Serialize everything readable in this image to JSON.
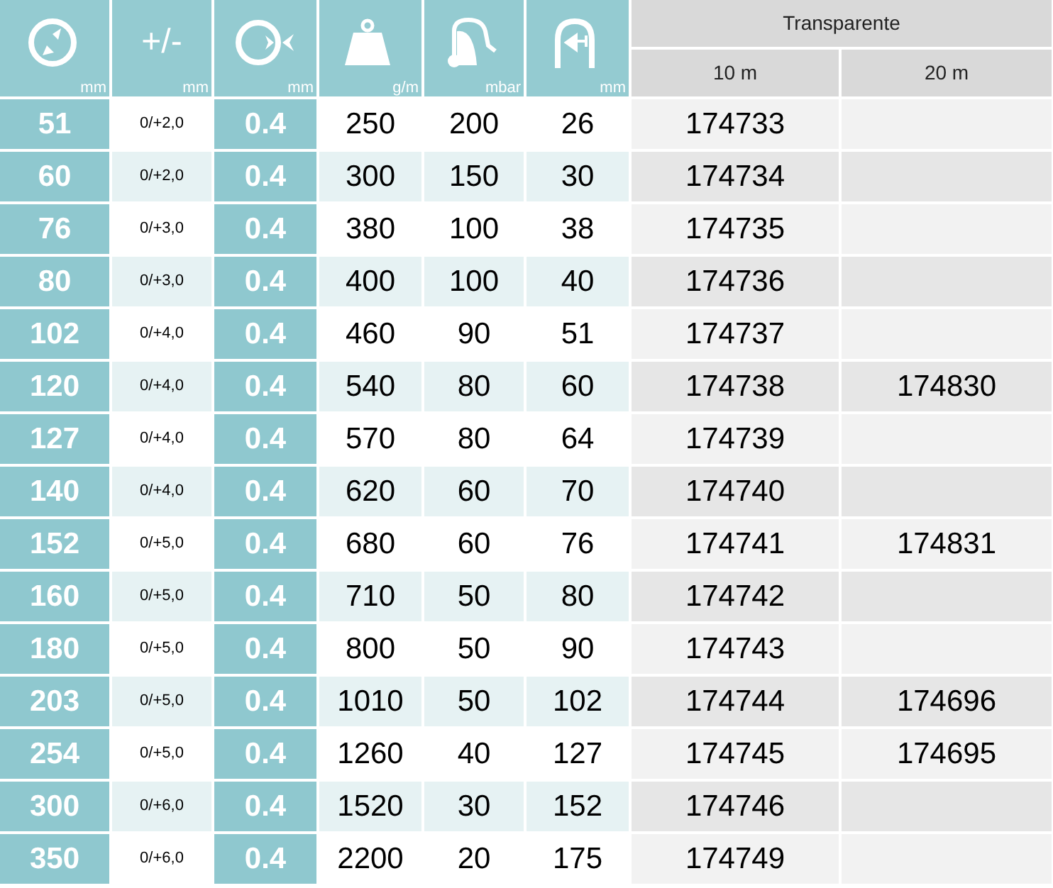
{
  "columns": [
    {
      "kind": "diameter",
      "unit": "mm"
    },
    {
      "kind": "tolerance",
      "symbol": "+/-",
      "unit": "mm"
    },
    {
      "kind": "wall",
      "unit": "mm"
    },
    {
      "kind": "weight",
      "unit": "g/m"
    },
    {
      "kind": "vacuum",
      "unit": "mbar"
    },
    {
      "kind": "bend",
      "unit": "mm"
    }
  ],
  "group_header": "Transparente",
  "sub_headers": [
    "10 m",
    "20 m"
  ],
  "rows": [
    {
      "cells": [
        "51",
        "0/+2,0",
        "0.4",
        "250",
        "200",
        "26"
      ],
      "code_10m": "174733"
    },
    {
      "cells": [
        "60",
        "0/+2,0",
        "0.4",
        "300",
        "150",
        "30"
      ],
      "code_10m": "174734"
    },
    {
      "cells": [
        "76",
        "0/+3,0",
        "0.4",
        "380",
        "100",
        "38"
      ],
      "code_10m": "174735"
    },
    {
      "cells": [
        "80",
        "0/+3,0",
        "0.4",
        "400",
        "100",
        "40"
      ],
      "code_10m": "174736"
    },
    {
      "cells": [
        "102",
        "0/+4,0",
        "0.4",
        "460",
        "90",
        "51"
      ],
      "code_10m": "174737"
    },
    {
      "cells": [
        "120",
        "0/+4,0",
        "0.4",
        "540",
        "80",
        "60"
      ],
      "code_10m": "174738",
      "code_20m": "174830"
    },
    {
      "cells": [
        "127",
        "0/+4,0",
        "0.4",
        "570",
        "80",
        "64"
      ],
      "code_10m": "174739"
    },
    {
      "cells": [
        "140",
        "0/+4,0",
        "0.4",
        "620",
        "60",
        "70"
      ],
      "code_10m": "174740"
    },
    {
      "cells": [
        "152",
        "0/+5,0",
        "0.4",
        "680",
        "60",
        "76"
      ],
      "code_10m": "174741",
      "code_20m": "174831"
    },
    {
      "cells": [
        "160",
        "0/+5,0",
        "0.4",
        "710",
        "50",
        "80"
      ],
      "code_10m": "174742"
    },
    {
      "cells": [
        "180",
        "0/+5,0",
        "0.4",
        "800",
        "50",
        "90"
      ],
      "code_10m": "174743"
    },
    {
      "cells": [
        "203",
        "0/+5,0",
        "0.4",
        "1010",
        "50",
        "102"
      ],
      "code_10m": "174744",
      "code_20m": "174696"
    },
    {
      "cells": [
        "254",
        "0/+5,0",
        "0.4",
        "1260",
        "40",
        "127"
      ],
      "code_10m": "174745",
      "code_20m": "174695"
    },
    {
      "cells": [
        "300",
        "0/+6,0",
        "0.4",
        "1520",
        "30",
        "152"
      ],
      "code_10m": "174746"
    },
    {
      "cells": [
        "350",
        "0/+6,0",
        "0.4",
        "2200",
        "20",
        "175"
      ],
      "code_10m": "174749"
    }
  ]
}
